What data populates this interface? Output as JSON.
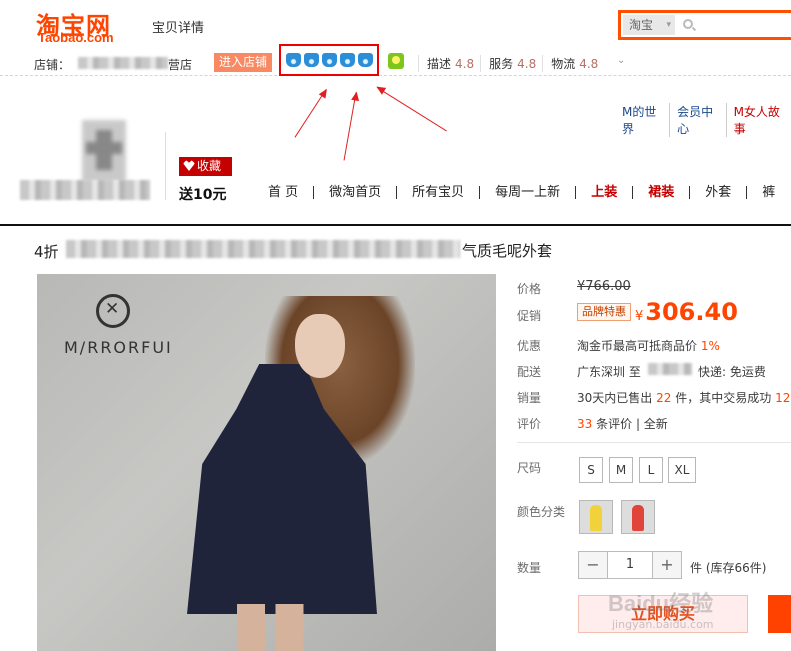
{
  "header": {
    "logo_cn": "淘宝网",
    "logo_en": "Taobao.com",
    "page_kind": "宝贝详情",
    "search_scope": "淘宝"
  },
  "shop": {
    "label": "店铺：",
    "name_suffix": "营店",
    "enter_button": "进入店铺",
    "crown_count": 5,
    "ratings": [
      {
        "label": "描述",
        "score": "4.8"
      },
      {
        "label": "服务",
        "score": "4.8"
      },
      {
        "label": "物流",
        "score": "4.8"
      }
    ]
  },
  "top_links": [
    "M的世界",
    "会员中心",
    "M女人故事"
  ],
  "shop_banner": {
    "favorite_button": "收藏",
    "send_prefix": "送",
    "send_amount": "10",
    "send_unit": "元"
  },
  "nav": [
    {
      "label": "首 页",
      "red": false
    },
    {
      "label": "微淘首页",
      "red": false
    },
    {
      "label": "所有宝贝",
      "red": false
    },
    {
      "label": "每周一上新",
      "red": false
    },
    {
      "label": "上装",
      "red": true
    },
    {
      "label": "裙装",
      "red": true
    },
    {
      "label": "外套",
      "red": false
    },
    {
      "label": "裤",
      "red": false
    }
  ],
  "product": {
    "title_start": "4折",
    "title_end": "气质毛呢外套",
    "brand_logo_text": "M/RRORFUI",
    "labels": {
      "price": "价格",
      "promo": "促销",
      "discount": "优惠",
      "shipping": "配送",
      "sales": "销量",
      "reviews": "评价",
      "size": "尺码",
      "color": "颜色分类",
      "quantity": "数量"
    },
    "price_old": "¥766.00",
    "promo_tag": "品牌特惠",
    "currency": "¥",
    "promo_price": "306.40",
    "discount_text": "淘金币最高可抵商品价",
    "discount_rate": "1%",
    "ship_from": "广东深圳 至",
    "ship_note": "快递: 免运费",
    "sales_prefix": "30天内已售出",
    "sales_count": "22",
    "sales_mid": "件，其中交易成功",
    "sales_success": "12",
    "reviews_count": "33",
    "reviews_suffix": "条评价",
    "reviews_all": "全新",
    "sizes": [
      "S",
      "M",
      "L",
      "XL"
    ],
    "colors": [
      "#f2d23a",
      "#e0443a"
    ],
    "quantity": "1",
    "quantity_minus": "−",
    "quantity_plus": "+",
    "stock_text": "件 (库存66件)",
    "buy_button": "立即购买",
    "watermark": "Baidu经验",
    "watermark_url": "jingyan.baidu.com"
  }
}
